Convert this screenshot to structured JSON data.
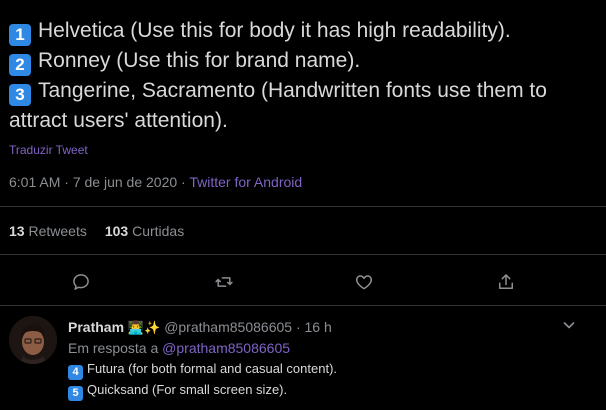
{
  "tweet": {
    "lines": [
      {
        "key": "1",
        "text": "Helvetica (Use this for body it has high readability)."
      },
      {
        "key": "2",
        "text": "Ronney (Use this for brand name)."
      },
      {
        "key": "3",
        "text": "Tangerine, Sacramento (Handwritten fonts use them to attract users' attention)."
      }
    ],
    "translate_label": "Traduzir Tweet",
    "time": "6:01 AM",
    "date": "7 de jun de 2020",
    "source": "Twitter for Android",
    "separator": "·",
    "retweets_count": "13",
    "retweets_label": "Retweets",
    "likes_count": "103",
    "likes_label": "Curtidas"
  },
  "actions": [
    {
      "icon": "reply-icon"
    },
    {
      "icon": "retweet-icon"
    },
    {
      "icon": "like-icon"
    },
    {
      "icon": "share-icon"
    }
  ],
  "reply": {
    "name": "Pratham",
    "emojis": "👨‍💻✨",
    "handle": "@pratham85086605",
    "time": "16 h",
    "separator": "·",
    "reply_prefix": "Em resposta a",
    "reply_handle": "@pratham85086605",
    "lines": [
      {
        "key": "4",
        "text": "Futura (for both formal and casual content)."
      },
      {
        "key": "5",
        "text": "Quicksand (For small screen size)."
      }
    ]
  },
  "colors": {
    "background": "#000000",
    "text": "#d9d9d9",
    "muted": "#8b8f93",
    "accent": "#7f64c6",
    "keycap": "#2f88e4",
    "divider": "#2f3336"
  }
}
